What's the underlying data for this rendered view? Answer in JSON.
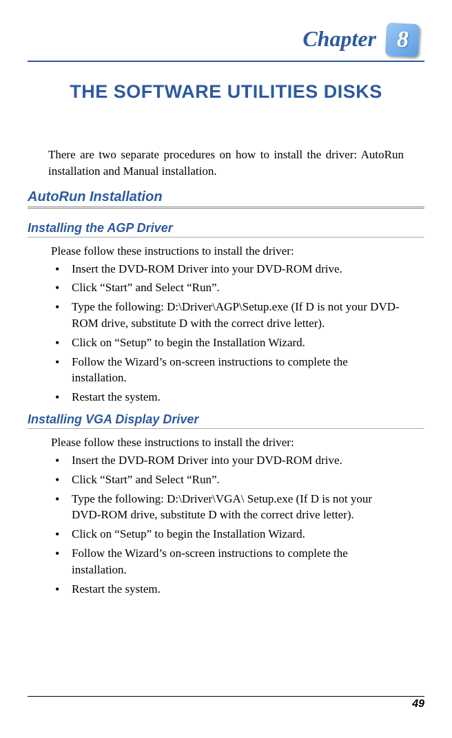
{
  "chapter": {
    "word": "Chapter",
    "number": "8"
  },
  "title": "THE SOFTWARE UTILITIES DISKS",
  "intro": "There are two separate procedures on how to install the driver: AutoRun installation and Manual installation.",
  "section1_heading": "AutoRun Installation",
  "agp": {
    "heading": "Installing the AGP Driver",
    "intro": "Please follow these instructions to install the driver:",
    "steps": [
      "Insert the DVD-ROM Driver into your DVD-ROM drive.",
      "Click “Start” and Select “Run”.",
      "Type the following: D:\\Driver\\AGP\\Setup.exe (If D is not your DVD-ROM drive, substitute D with the correct drive letter).",
      "Click on “Setup” to begin the Installation Wizard.",
      "Follow the Wizard’s on-screen instructions to complete the installation.",
      "Restart the system."
    ]
  },
  "vga": {
    "heading": "Installing VGA Display Driver",
    "intro": "Please follow these instructions to install the driver:",
    "steps": [
      "Insert the DVD-ROM Driver into your DVD-ROM drive.",
      "Click “Start” and Select “Run”.",
      "Type the following: D:\\Driver\\VGA\\ Setup.exe (If D is not your DVD-ROM drive, substitute D with the correct drive letter).",
      "Click on “Setup” to begin the Installation Wizard.",
      "Follow the Wizard’s on-screen instructions to complete the installation.",
      "Restart the system."
    ]
  },
  "page_number": "49"
}
